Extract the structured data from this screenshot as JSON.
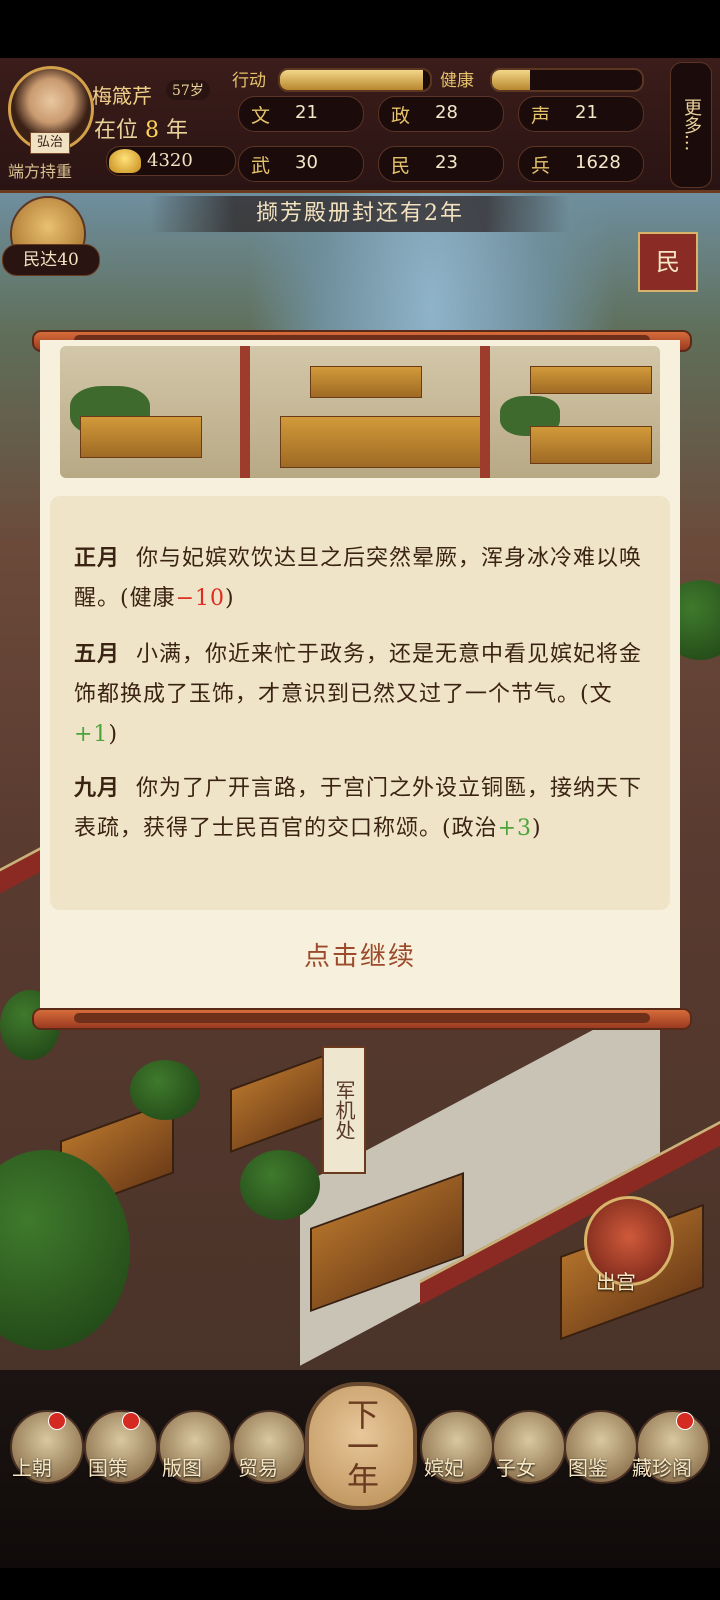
{
  "hud": {
    "avatar_seal": "弘治",
    "emperor_name": "梅箴芹",
    "age": "57岁",
    "reign_label": "在位",
    "reign_years": "8",
    "reign_unit": "年",
    "title": "端方持重",
    "gold": "4320",
    "action_label": "行动",
    "health_label": "健康",
    "action_fraction": 0.95,
    "health_fraction": 0.25,
    "stats": [
      {
        "key": "文",
        "value": "21"
      },
      {
        "key": "政",
        "value": "28"
      },
      {
        "key": "声",
        "value": "21"
      },
      {
        "key": "武",
        "value": "30"
      },
      {
        "key": "民",
        "value": "23"
      },
      {
        "key": "兵",
        "value": "1628"
      }
    ],
    "more_label": "更多..."
  },
  "banner": "撷芳殿册封还有2年",
  "side": {
    "min_badge_prefix": "民",
    "min_badge_suffix": "达40",
    "right_button": "民"
  },
  "modal": {
    "paragraphs": [
      {
        "month": "正月",
        "text": "你与妃嫔欢饮达旦之后突然晕厥，浑身冰冷难以唤醒。(健康",
        "delta": "−10",
        "delta_kind": "neg",
        "close": ")"
      },
      {
        "month": "五月",
        "text": "小满，你近来忙于政务，还是无意中看见嫔妃将金饰都换成了玉饰，才意识到已然又过了一个节气。(文",
        "delta": "+1",
        "delta_kind": "pos",
        "close": ")"
      },
      {
        "month": "九月",
        "text": "你为了广开言路，于宫门之外设立铜匦，接纳天下表疏，获得了士民百官的交口称颂。(政治",
        "delta": "+3",
        "delta_kind": "pos",
        "close": ")"
      }
    ],
    "continue_label": "点击继续"
  },
  "map": {
    "marker": "军机处",
    "exit_label": "出宫"
  },
  "bottom": {
    "buttons": [
      "上朝",
      "国策",
      "版图",
      "贸易",
      "嫔妃",
      "子女",
      "图鉴",
      "藏珍阁"
    ],
    "next_year": "下一年"
  }
}
